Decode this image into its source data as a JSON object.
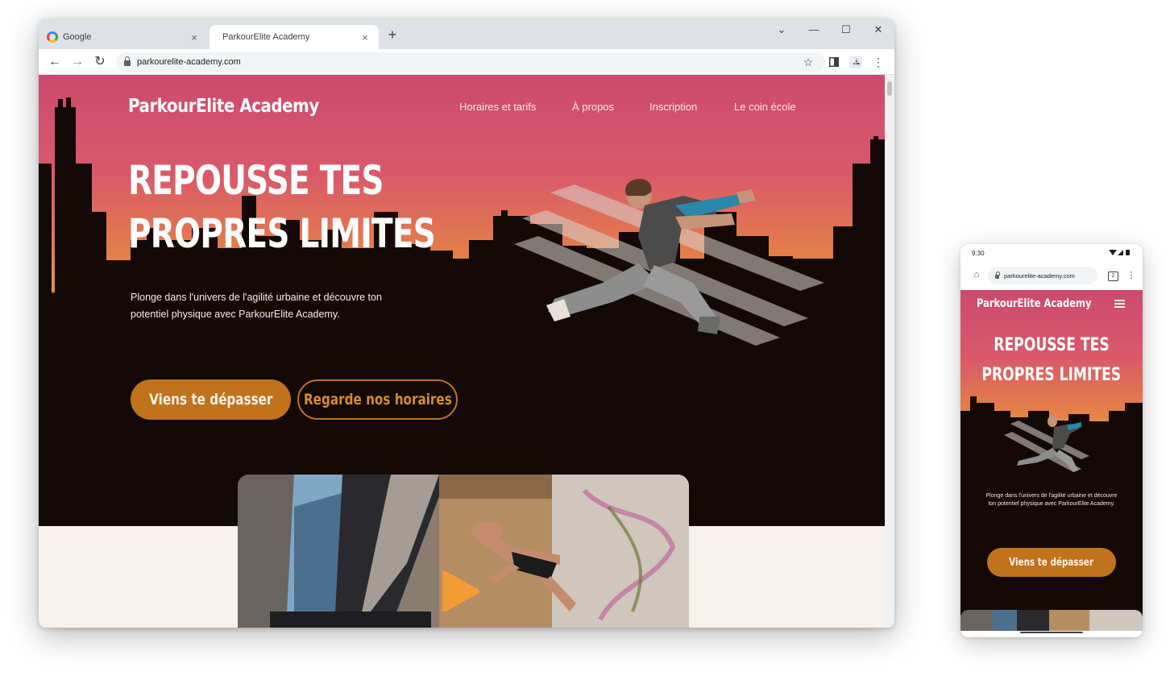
{
  "desktop": {
    "tabs": [
      {
        "title": "Google",
        "close": "×"
      },
      {
        "title": "ParkourElite Academy",
        "close": "×"
      }
    ],
    "new_tab": "+",
    "window_controls": {
      "dropdown": "⌄",
      "minimize": "—",
      "maximize": "☐",
      "close": "✕"
    },
    "toolbar": {
      "back": "←",
      "forward": "→",
      "reload": "↻",
      "url": "parkourelite-academy.com",
      "bookmark": "☆",
      "menu": "⋮"
    }
  },
  "site": {
    "logo": "ParkourElite Academy",
    "nav": [
      "Horaires et tarifs",
      "À propos",
      "Inscription",
      "Le coin école"
    ],
    "headline": [
      "REPOUSSE TES",
      "PROPRES LIMITES"
    ],
    "lead": "Plonge dans l'univers de l'agilité urbaine et découvre ton potentiel physique avec ParkourElite Academy.",
    "cta_primary": "Viens te dépasser",
    "cta_secondary": "Regarde nos horaires"
  },
  "mobile": {
    "time": "9:30",
    "url": "parkourelite-academy.com",
    "tab_count": "2",
    "menu": "⋮",
    "home": "⌂",
    "logo": "ParkourElite Academy",
    "headline": [
      "REPOUSSE TES",
      "PROPRES LIMITES"
    ],
    "lead": "Plonge dans l'univers de l'agilité urbaine et découvre ton potentiel physique avec ParkourElite Academy.",
    "cta": "Viens te dépasser"
  },
  "colors": {
    "hero_pink": "#cc4a6e",
    "hero_orange": "#e89447",
    "hero_dark": "#130a08",
    "accent_orange": "#c0721d",
    "cream": "#f7f2ee"
  }
}
